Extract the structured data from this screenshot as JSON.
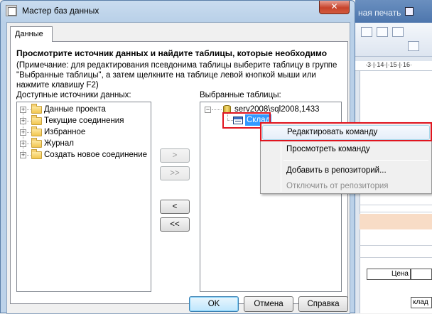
{
  "dialog": {
    "title": "Мастер баз данных",
    "close_label": "✕",
    "tab_label": "Данные",
    "heading": "Просмотрите источник данных и найдите таблицы, которые необходимо",
    "note": "(Примечание: для редактирования псевдонима таблицы выберите таблицу в группе \"Выбранные таблицы\", а затем щелкните на таблице левой кнопкой мыши или нажмите клавишу F2)",
    "available_label": "Доступные источники данных:",
    "selected_label": "Выбранные таблицы:",
    "available_items": [
      {
        "label": "Данные проекта"
      },
      {
        "label": "Текущие соединения"
      },
      {
        "label": "Избранное"
      },
      {
        "label": "Журнал"
      },
      {
        "label": "Создать новое соединение"
      }
    ],
    "server_label": "serv2008\\sql2008,1433",
    "selected_table": "Склад",
    "buttons": {
      "add": ">",
      "add_all": ">>",
      "remove": "<",
      "remove_all": "<<",
      "ok": "OK",
      "cancel": "Отмена",
      "help": "Справка"
    }
  },
  "context_menu": {
    "items": [
      {
        "label": "Редактировать команду",
        "state": "hover"
      },
      {
        "label": "Просмотреть команду",
        "state": "normal"
      },
      {
        "label": "Добавить в репозиторий...",
        "state": "normal"
      },
      {
        "label": "Отключить от репозитория",
        "state": "disabled"
      }
    ]
  },
  "background_app": {
    "title": "ная печать",
    "ruler": "·3·|·14·|·15·|·16·",
    "cell_price": "Цена",
    "cell_stock": "клад"
  }
}
